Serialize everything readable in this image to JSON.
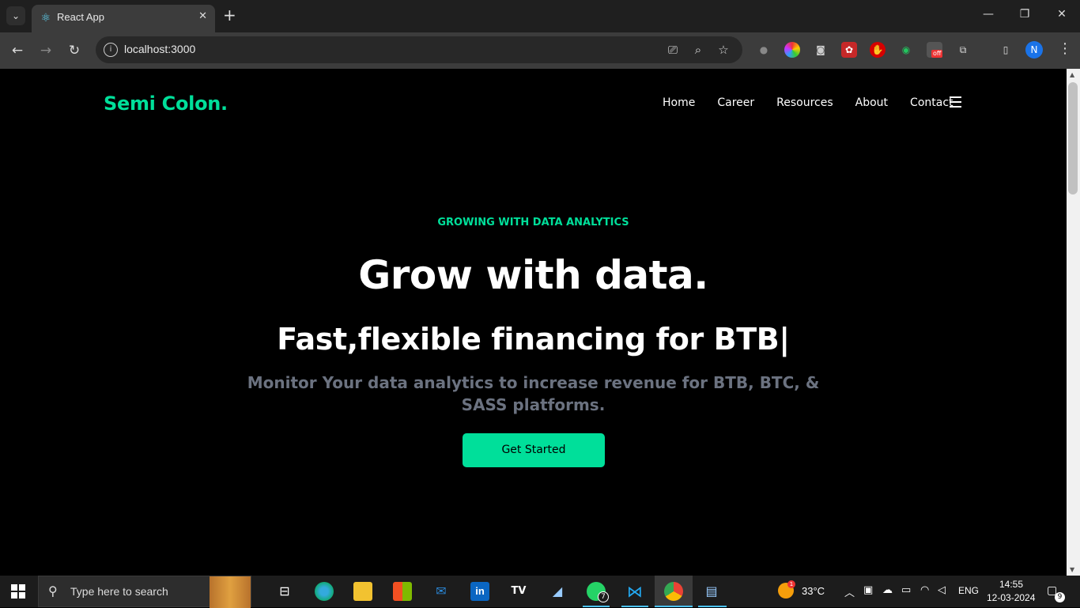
{
  "browser": {
    "tab_title": "React App",
    "url": "localhost:3000",
    "profile_initial": "N",
    "extension_badge": "off"
  },
  "site": {
    "logo": "Semi Colon.",
    "nav": [
      "Home",
      "Career",
      "Resources",
      "About",
      "Contact"
    ],
    "eyebrow": "GROWING WITH DATA ANALYTICS",
    "title": "Grow with data.",
    "typed_text": "Fast,flexible financing for BTB|",
    "description": "Monitor Your data analytics to increase revenue for BTB, BTC, & SASS platforms.",
    "cta": "Get Started"
  },
  "taskbar": {
    "search_placeholder": "Type here to search",
    "whatsapp_badge": "7",
    "weather_badge": "1",
    "temperature": "33°C",
    "language": "ENG",
    "time": "14:55",
    "date": "12-03-2024",
    "notification_count": "9"
  },
  "colors": {
    "accent": "#00df9a",
    "muted_text": "#6b7280",
    "page_bg": "#000000"
  }
}
